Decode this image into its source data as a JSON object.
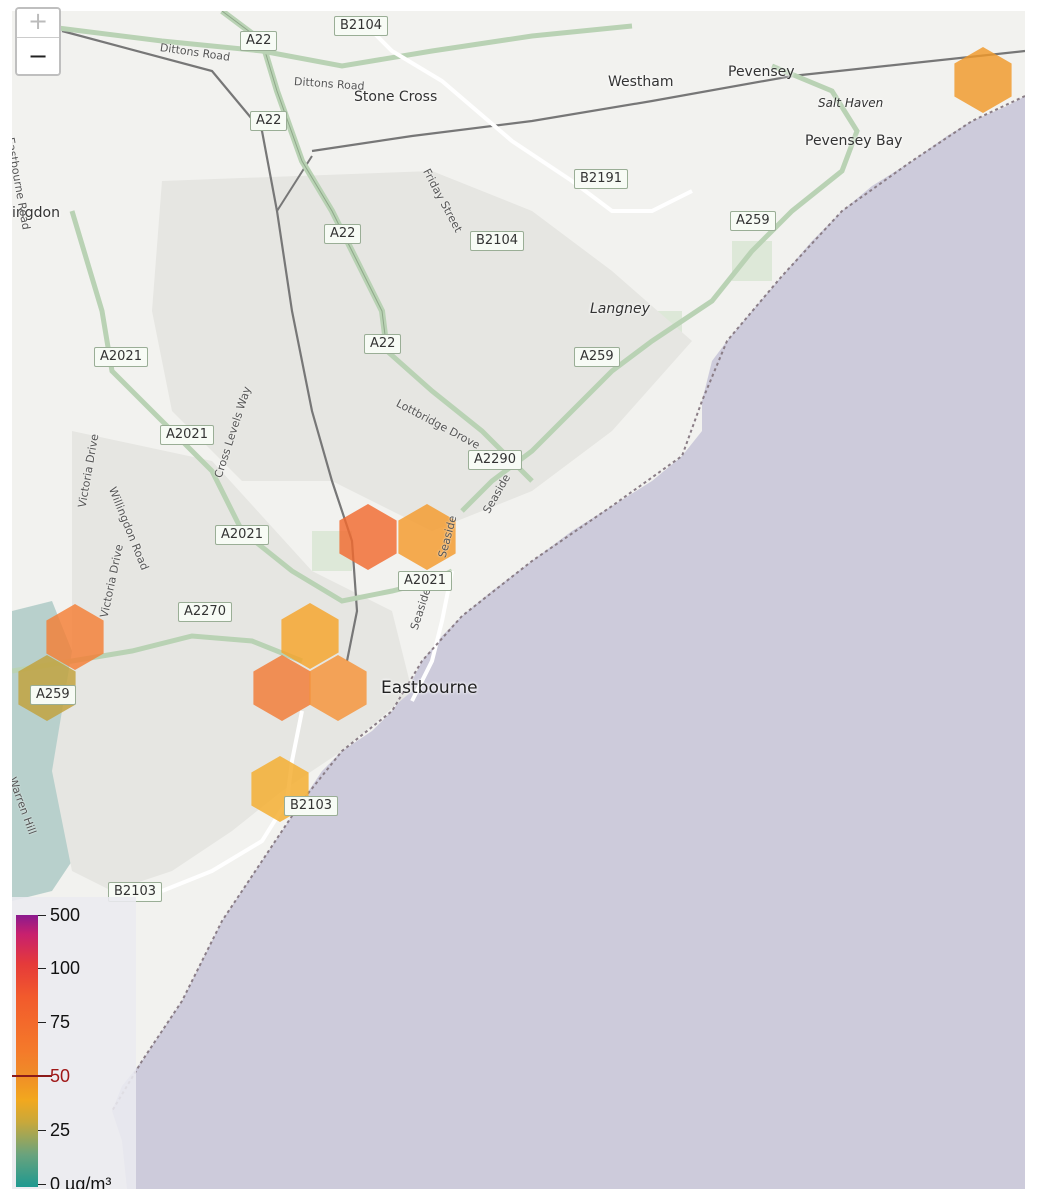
{
  "map": {
    "places": {
      "stone_cross": "Stone Cross",
      "westham": "Westham",
      "pevensey": "Pevensey",
      "pevensey_bay": "Pevensey Bay",
      "salt_haven": "Salt Haven",
      "willingdon": "ingdon",
      "langney": "Langney",
      "eastbourne": "Eastbourne"
    },
    "streets": {
      "dittons_road_1": "Dittons Road",
      "dittons_road_2": "Dittons Road",
      "eastbourne_road": "Eastbourne Road",
      "friday_street": "Friday Street",
      "lottbridge_drove": "Lottbridge Drove",
      "cross_levels_way": "Cross Levels Way",
      "willingdon_road": "Willingdon Road",
      "victoria_drive_1": "Victoria Drive",
      "victoria_drive_2": "Victoria Drive",
      "seaside_1": "Seaside",
      "seaside_2": "Seaside",
      "seaside_3": "Seaside",
      "warren_hill": "Warren Hill"
    },
    "road_shields": {
      "b2104_top": "B2104",
      "a22_top": "A22",
      "a22_mid1": "A22",
      "a22_mid2": "A22",
      "a22_mid3": "A22",
      "b2191": "B2191",
      "b2104_mid": "B2104",
      "a259_east": "A259",
      "a2021_w": "A2021",
      "a259_mid": "A259",
      "a2021_mid": "A2021",
      "a2290": "A2290",
      "a2021_low": "A2021",
      "a2021_center": "A2021",
      "a2270": "A2270",
      "a259_west": "A259",
      "b2103_center": "B2103",
      "b2103_south": "B2103"
    }
  },
  "zoom": {
    "in_label": "+",
    "out_label": "−"
  },
  "legend": {
    "labels": {
      "l500": "500",
      "l100": "100",
      "l75": "75",
      "l50": "50",
      "l25": "25",
      "l0": "0 µg/m³"
    },
    "threshold_color": "#8b1a1a"
  },
  "colors": {
    "sea": "#cdcbdb",
    "land": "#f2f2ef",
    "road_green": "#b9d2b4",
    "road_main": "#8fa88a"
  },
  "hexbins": [
    {
      "id": "hex-pevensey-bay",
      "color": "#f0982a"
    },
    {
      "id": "hex-north-a",
      "color": "#f26a30"
    },
    {
      "id": "hex-north-b",
      "color": "#f49a2c"
    },
    {
      "id": "hex-west",
      "color": "#f47e34"
    },
    {
      "id": "hex-west-low",
      "color": "#c2a13a"
    },
    {
      "id": "hex-center-top",
      "color": "#f5a42a"
    },
    {
      "id": "hex-center-left",
      "color": "#f27a34"
    },
    {
      "id": "hex-center-right",
      "color": "#f59238"
    },
    {
      "id": "hex-south",
      "color": "#f4ac2c"
    }
  ]
}
